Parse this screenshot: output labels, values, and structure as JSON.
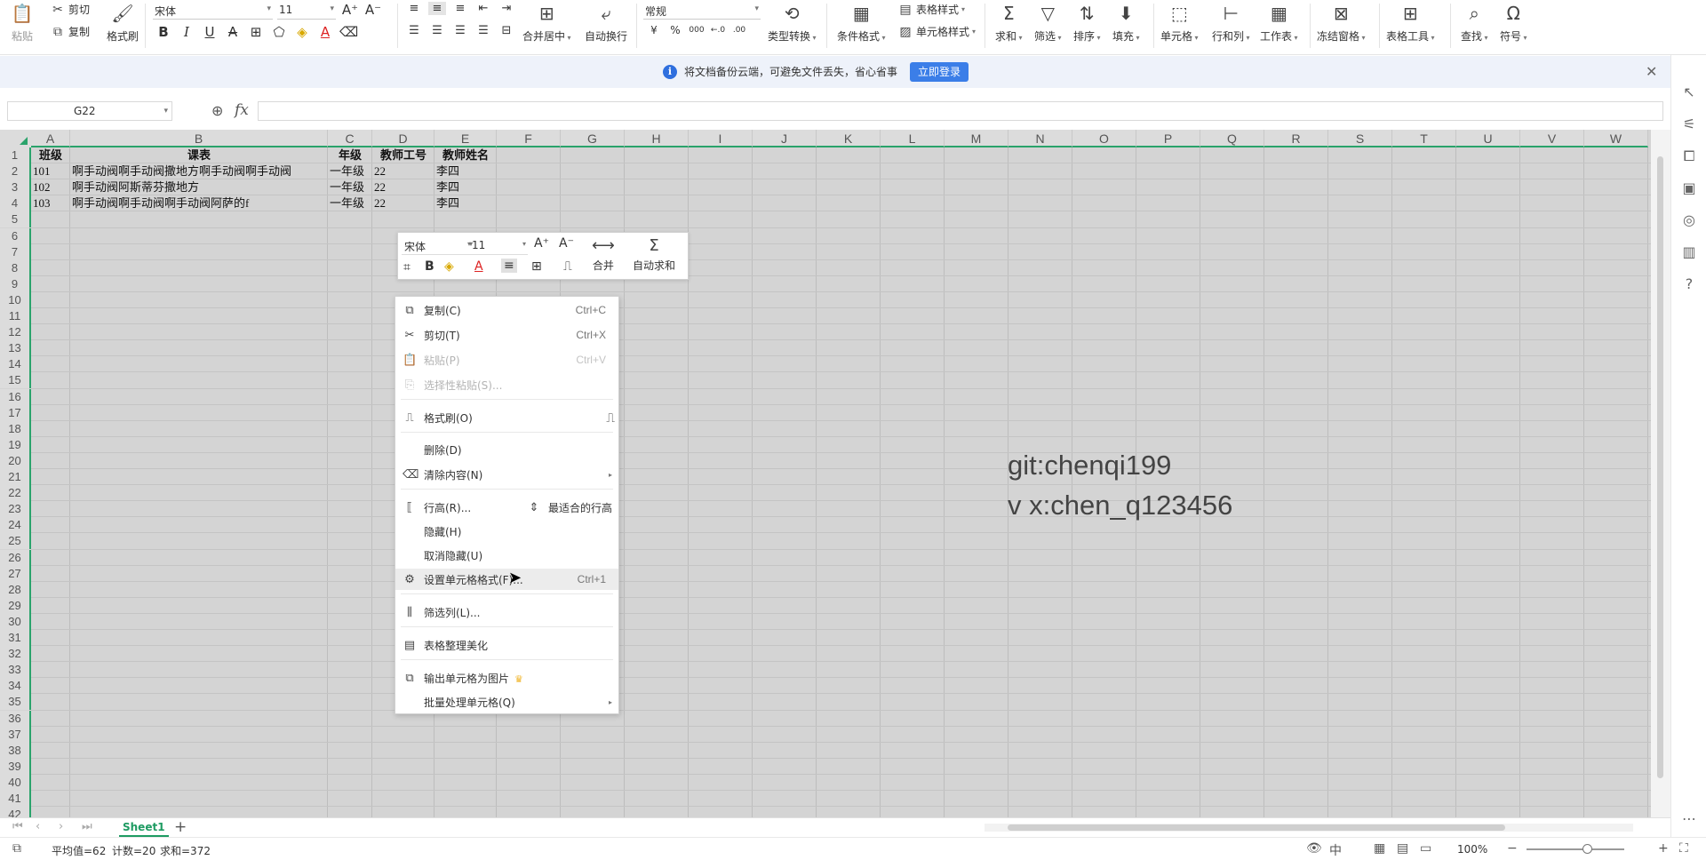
{
  "ribbon": {
    "paste": "粘贴",
    "cut": "剪切",
    "copy": "复制",
    "format_painter": "格式刷",
    "font_name": "宋体",
    "font_size": "11",
    "merge_center": "合并居中",
    "wrap_text": "自动换行",
    "number_format": "常规",
    "currency_symbol": "¥",
    "percent_symbol": "%",
    "thousands_symbol": "000",
    "type_convert": "类型转换",
    "conditional_format": "条件格式",
    "table_style": "表格样式",
    "cell_style": "单元格样式",
    "sum": "求和",
    "filter": "筛选",
    "sort": "排序",
    "fill": "填充",
    "cell": "单元格",
    "row_col": "行和列",
    "worksheet": "工作表",
    "freeze": "冻结窗格",
    "table_tools": "表格工具",
    "find": "查找",
    "symbol": "符号"
  },
  "infobar": {
    "message": "将文档备份云端，可避免文件丢失，省心省事",
    "login_button": "立即登录"
  },
  "formula": {
    "cell_ref": "G22",
    "fx_label": "fx",
    "formula_value": ""
  },
  "columns": [
    "A",
    "B",
    "C",
    "D",
    "E",
    "F",
    "G",
    "H",
    "I",
    "J",
    "K",
    "L",
    "M",
    "N",
    "O",
    "P",
    "Q",
    "R",
    "S",
    "T",
    "U",
    "V",
    "W"
  ],
  "rows": [
    "1",
    "2",
    "3",
    "4",
    "5",
    "6",
    "7",
    "8",
    "9",
    "10",
    "11",
    "12",
    "13",
    "14",
    "15",
    "16",
    "17",
    "18",
    "19",
    "20",
    "21",
    "22",
    "23",
    "24",
    "25",
    "26",
    "27",
    "28",
    "29",
    "30",
    "31",
    "32",
    "33",
    "34",
    "35",
    "36",
    "37",
    "38",
    "39",
    "40",
    "41",
    "42"
  ],
  "table": {
    "headers": [
      "班级",
      "课表",
      "年级",
      "教师工号",
      "教师姓名"
    ],
    "data": [
      [
        "101",
        "啊手动阀啊手动阀撒地方啊手动阀啊手动阀",
        "一年级",
        "22",
        "李四"
      ],
      [
        "102",
        "啊手动阀阿斯蒂芬撒地方",
        "一年级",
        "22",
        "李四"
      ],
      [
        "103",
        "啊手动阀啊手动阀啊手动阀阿萨的f",
        "一年级",
        "22",
        "李四"
      ]
    ]
  },
  "watermark": {
    "line1": "git:chenqi199",
    "line2": "v x:chen_q123456"
  },
  "mini_toolbar": {
    "font_name": "宋体",
    "font_size": "11",
    "merge": "合并",
    "autosum": "自动求和"
  },
  "context_menu": {
    "copy": "复制(C)",
    "copy_sc": "Ctrl+C",
    "cut": "剪切(T)",
    "cut_sc": "Ctrl+X",
    "paste": "粘贴(P)",
    "paste_sc": "Ctrl+V",
    "paste_special": "选择性粘贴(S)...",
    "format_painter": "格式刷(O)",
    "delete": "删除(D)",
    "clear": "清除内容(N)",
    "row_height": "行高(R)...",
    "best_fit_row": "最适合的行高",
    "hide": "隐藏(H)",
    "unhide": "取消隐藏(U)",
    "format_cells": "设置单元格格式(F)...",
    "format_cells_sc": "Ctrl+1",
    "filter_col": "筛选列(L)...",
    "beautify": "表格整理美化",
    "export_image": "输出单元格为图片",
    "batch": "批量处理单元格(Q)"
  },
  "sheet_tab": "Sheet1",
  "status": {
    "average": "平均值=62",
    "count": "计数=20",
    "sum": "求和=372",
    "zoom": "100%"
  },
  "colors": {
    "accent_green": "#2aa36b",
    "brand_blue": "#3b7ee8",
    "crown": "#f0b429"
  }
}
